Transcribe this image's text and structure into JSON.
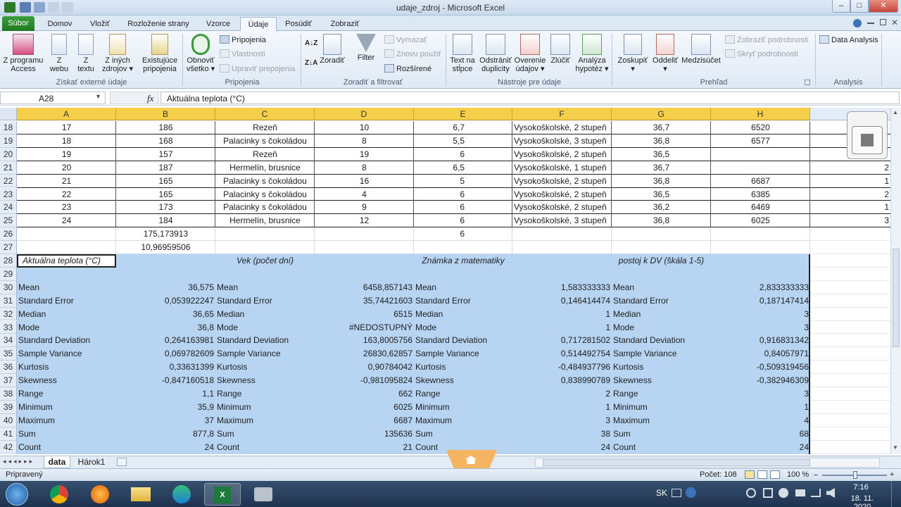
{
  "window": {
    "title": "udaje_zdroj - Microsoft Excel",
    "min": "–",
    "max": "□",
    "close": "✕"
  },
  "tabs": [
    "Súbor",
    "Domov",
    "Vložiť",
    "Rozloženie strany",
    "Vzorce",
    "Údaje",
    "Posúdiť",
    "Zobraziť"
  ],
  "ribbon": {
    "from_access": [
      "Z programu",
      "Access"
    ],
    "from_web": [
      "Z",
      "webu"
    ],
    "from_text": [
      "Z",
      "textu"
    ],
    "from_other": [
      "Z iných",
      "zdrojov ▾"
    ],
    "existing": [
      "Existujúce",
      "pripojenia"
    ],
    "refresh": [
      "Obnoviť",
      "všetko ▾"
    ],
    "connections": "Pripojenia",
    "properties": "Vlastnosti",
    "edit_links": "Upraviť prepojenia",
    "sort": "Zoradiť",
    "filter": "Filter",
    "clear": "Vymazať",
    "reapply": "Znovu použiť",
    "advanced": "Rozšírené",
    "text_to_cols": [
      "Text na",
      "stĺpce"
    ],
    "remove_dup": [
      "Odstrániť",
      "duplicity"
    ],
    "validation": [
      "Overenie",
      "údajov ▾"
    ],
    "consolidate": "Zlúčiť",
    "whatif": [
      "Analýza",
      "hypotéz ▾"
    ],
    "group": [
      "Zoskupiť",
      "▾"
    ],
    "ungroup": [
      "Oddeliť",
      "▾"
    ],
    "subtotal": "Medzisúčet",
    "show_detail": "Zobraziť podrobnosti",
    "hide_detail": "Skryť podrobnosti",
    "data_analysis": "Data Analysis",
    "groups": [
      "Získať externé údaje",
      "Pripojenia",
      "Zoradiť a filtrovať",
      "Nástroje pre údaje",
      "Prehľad",
      "Analysis"
    ]
  },
  "formula_bar": {
    "name_box": "A28",
    "fx": "fx",
    "formula": "Aktuálna teplota (°C)"
  },
  "columns": [
    "A",
    "B",
    "C",
    "D",
    "E",
    "F",
    "G",
    "H"
  ],
  "rows": [
    {
      "n": "18",
      "cells": [
        "17",
        "186",
        "Rezeň",
        "10",
        "6,7",
        "Vysokoškolské, 2 stupeň",
        "36,7",
        "6520",
        ""
      ]
    },
    {
      "n": "19",
      "cells": [
        "18",
        "168",
        "Palacinky s čokoládou",
        "8",
        "5,5",
        "Vysokoškolské, 3 stupeň",
        "36,8",
        "6577",
        ""
      ]
    },
    {
      "n": "20",
      "cells": [
        "19",
        "157",
        "Rezeň",
        "19",
        "6",
        "Vysokoškolské, 2 stupeň",
        "36,5",
        "",
        ""
      ]
    },
    {
      "n": "21",
      "cells": [
        "20",
        "187",
        "Hermelín, brusnice",
        "8",
        "6,5",
        "Vysokoškolské, 1 stupeň",
        "36,7",
        "",
        "2"
      ]
    },
    {
      "n": "22",
      "cells": [
        "21",
        "165",
        "Palacinky s čokoládou",
        "16",
        "5",
        "Vysokoškolské, 2 stupeň",
        "36,8",
        "6687",
        "1"
      ]
    },
    {
      "n": "23",
      "cells": [
        "22",
        "165",
        "Palacinky s čokoládou",
        "4",
        "6",
        "Vysokoškolské, 2 stupeň",
        "36,5",
        "6385",
        "2"
      ]
    },
    {
      "n": "24",
      "cells": [
        "23",
        "173",
        "Palacinky s čokoládou",
        "9",
        "6",
        "Vysokoškolské, 2 stupeň",
        "36,2",
        "6469",
        "1"
      ]
    },
    {
      "n": "25",
      "cells": [
        "24",
        "184",
        "Hermelín, brusnice",
        "12",
        "6",
        "Vysokoškolské, 3 stupeň",
        "36,8",
        "6025",
        "3"
      ]
    }
  ],
  "row26": {
    "n": "26",
    "b": "175,173913",
    "e": "6"
  },
  "row27": {
    "n": "27",
    "b": "10,96959506"
  },
  "headers28": {
    "n": "28",
    "a": "Aktuálna teplota (°C)",
    "c": "Vek (počet dní)",
    "e": "Známka z matematiky",
    "g": "postoj k DV (škála 1-5)"
  },
  "row29": {
    "n": "29"
  },
  "stats": [
    {
      "n": "30",
      "label": "Mean",
      "v1": "36,575",
      "v2": "6458,857143",
      "v3": "1,583333333",
      "v4": "2,833333333"
    },
    {
      "n": "31",
      "label": "Standard Error",
      "v1": "0,053922247",
      "v2": "35,74421603",
      "v3": "0,146414474",
      "v4": "0,187147414"
    },
    {
      "n": "32",
      "label": "Median",
      "v1": "36,65",
      "v2": "6515",
      "v3": "1",
      "v4": "3"
    },
    {
      "n": "33",
      "label": "Mode",
      "v1": "36,8",
      "v2": "#NEDOSTUPNÝ",
      "v3": "1",
      "v4": "3"
    },
    {
      "n": "34",
      "label": "Standard Deviation",
      "v1": "0,264163981",
      "v2": "163,8005756",
      "v3": "0,717281502",
      "v4": "0,916831342"
    },
    {
      "n": "35",
      "label": "Sample Variance",
      "v1": "0,069782609",
      "v2": "26830,62857",
      "v3": "0,514492754",
      "v4": "0,84057971"
    },
    {
      "n": "36",
      "label": "Kurtosis",
      "v1": "0,33631399",
      "v2": "0,90784042",
      "v3": "-0,484937796",
      "v4": "-0,509319456"
    },
    {
      "n": "37",
      "label": "Skewness",
      "v1": "-0,847160518",
      "v2": "-0,981095824",
      "v3": "0,838990789",
      "v4": "-0,382946309"
    },
    {
      "n": "38",
      "label": "Range",
      "v1": "1,1",
      "v2": "662",
      "v3": "2",
      "v4": "3"
    },
    {
      "n": "39",
      "label": "Minimum",
      "v1": "35,9",
      "v2": "6025",
      "v3": "1",
      "v4": "1"
    },
    {
      "n": "40",
      "label": "Maximum",
      "v1": "37",
      "v2": "6687",
      "v3": "3",
      "v4": "4"
    },
    {
      "n": "41",
      "label": "Sum",
      "v1": "877,8",
      "v2": "135636",
      "v3": "38",
      "v4": "68"
    },
    {
      "n": "42",
      "label": "Count",
      "v1": "24",
      "v2": "21",
      "v3": "24",
      "v4": "24"
    }
  ],
  "sheets": [
    "data",
    "Hárok1"
  ],
  "status": {
    "ready": "Pripravený",
    "count": "Počet: 108",
    "zoom": "100 %"
  },
  "tray": {
    "lang": "SK",
    "time": "7:16",
    "date": "18. 11. 2020"
  },
  "colors": {
    "accent": "#1f7a1f",
    "selection": "#b7d5f3",
    "colheader": "#f6cf4a"
  }
}
